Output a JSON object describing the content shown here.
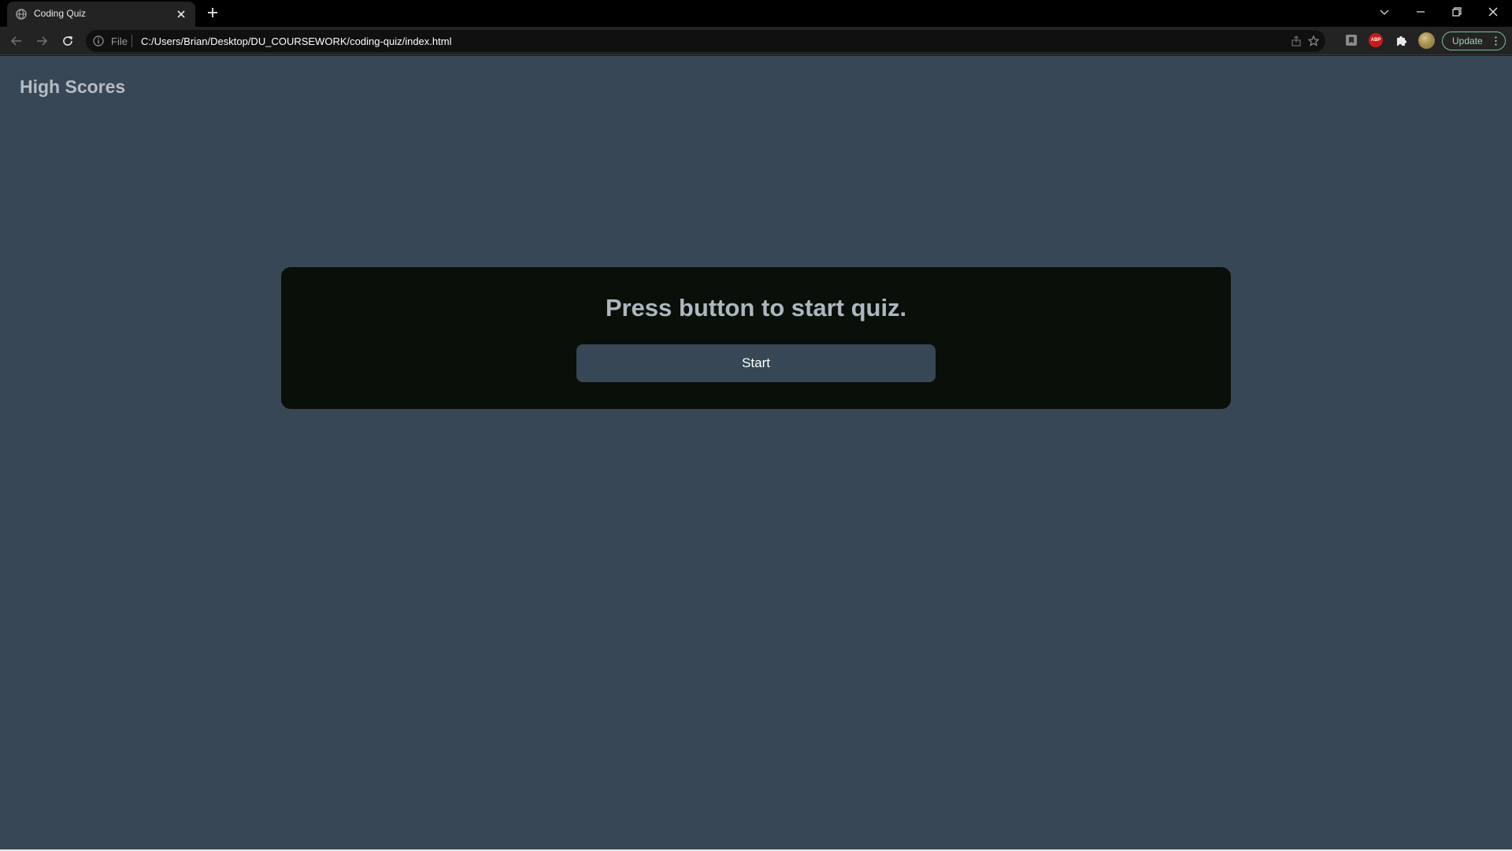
{
  "browser": {
    "tab": {
      "title": "Coding Quiz",
      "favicon": "globe-icon",
      "close": "close-icon"
    },
    "new_tab": "plus-icon",
    "window_controls": [
      "chevron-down-icon",
      "minimize-icon",
      "restore-icon",
      "close-icon"
    ],
    "nav": [
      "back-arrow-icon",
      "forward-arrow-icon",
      "reload-icon"
    ],
    "address_bar": {
      "info_icon": "info-icon",
      "scheme": "File",
      "url": "C:/Users/Brian/Desktop/DU_COURSEWORK/coding-quiz/index.html",
      "actions": [
        "share-icon",
        "star-icon"
      ]
    },
    "extensions": {
      "abp_label": "ABP",
      "icons": [
        "bookmark-extension-icon",
        "adblock-icon",
        "puzzle-icon"
      ]
    },
    "profile": "avatar",
    "update_label": "Update",
    "colors": {
      "tabstrip": "#000000",
      "toolbar": "#232323",
      "update_accent": "#7fc197"
    }
  },
  "page": {
    "high_scores_label": "High Scores",
    "quiz": {
      "prompt": "Press button to start quiz.",
      "start_label": "Start"
    },
    "colors": {
      "background": "#374755",
      "card": "#0a0f0a",
      "heading_text": "#aeb7c0"
    }
  }
}
